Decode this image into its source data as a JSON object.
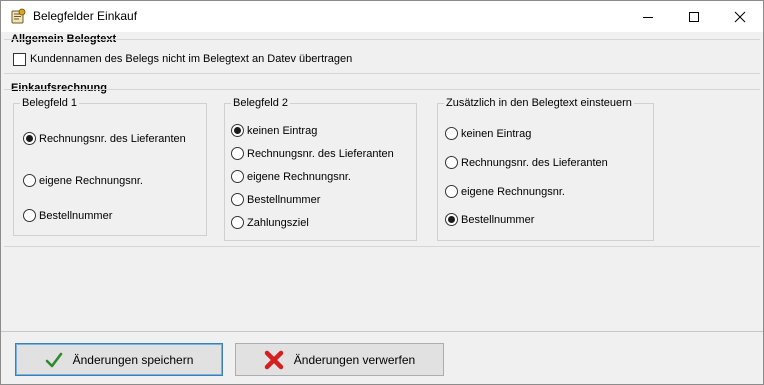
{
  "window": {
    "title": "Belegfelder Einkauf",
    "icon": "app-icon"
  },
  "allgemein": {
    "heading": "Allgemein Belegtext",
    "checkbox_label": "Kundennamen des Belegs nicht im Belegtext an Datev übertragen",
    "checked": false
  },
  "einkauf": {
    "heading": "Einkaufsrechnung",
    "belegfeld1": {
      "label": "Belegfeld 1",
      "options": [
        "Rechnungsnr. des Lieferanten",
        "eigene Rechnungsnr.",
        "Bestellnummer"
      ],
      "selected": "Rechnungsnr. des Lieferanten"
    },
    "belegfeld2": {
      "label": "Belegfeld 2",
      "options": [
        "keinen Eintrag",
        "Rechnungsnr. des Lieferanten",
        "eigene Rechnungsnr.",
        "Bestellnummer",
        "Zahlungsziel"
      ],
      "selected": "keinen Eintrag"
    },
    "zusaetzlich": {
      "label": "Zusätzlich in den Belegtext einsteuern",
      "options": [
        "keinen Eintrag",
        "Rechnungsnr. des Lieferanten",
        "eigene Rechnungsnr.",
        "Bestellnummer"
      ],
      "selected": "Bestellnummer"
    }
  },
  "buttons": {
    "save_label": "Änderungen speichern",
    "discard_label": "Änderungen verwerfen"
  },
  "colors": {
    "save_icon": "#2e8b2e",
    "discard_icon": "#d42020"
  }
}
